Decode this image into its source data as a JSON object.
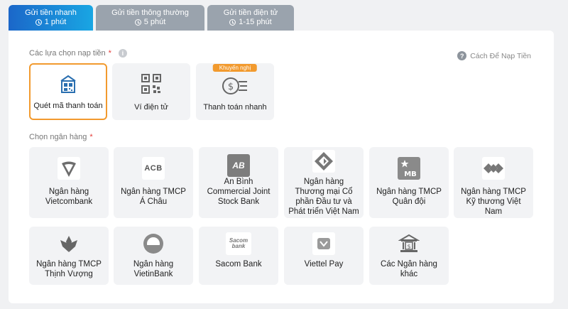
{
  "tabs": [
    {
      "label": "Gửi tiền nhanh",
      "time": "1 phút",
      "active": true
    },
    {
      "label": "Gửi tiền thông thường",
      "time": "5 phút",
      "active": false
    },
    {
      "label": "Gửi tiền điện tử",
      "time": "1-15 phút",
      "active": false
    }
  ],
  "deposit_options": {
    "label": "Các lựa chọn nạp tiền",
    "required_mark": "*",
    "info_icon": "i",
    "guide": {
      "icon": "?",
      "label": "Cách Để Nạp Tiền"
    },
    "methods": [
      {
        "label": "Quét mã thanh toán",
        "icon": "qr-scan-icon"
      },
      {
        "label": "Ví điện tử",
        "icon": "qr-code-icon"
      },
      {
        "label": "Thanh toán nhanh",
        "icon": "fast-payment-icon",
        "badge": "Khuyến nghị"
      }
    ]
  },
  "bank_section": {
    "label": "Chọn ngân hàng",
    "required_mark": "*"
  },
  "banks": [
    {
      "name": "Ngân hàng Vietcombank",
      "logo_text": ""
    },
    {
      "name": "Ngân hàng TMCP Á Châu",
      "logo_text": "ACB"
    },
    {
      "name": "An Bình Commercial Joint Stock Bank",
      "logo_text": "AB"
    },
    {
      "name": "Ngân hàng Thương mại Cổ phần Đầu tư và Phát triển Việt Nam",
      "logo_text": ""
    },
    {
      "name": "Ngân hàng TMCP Quân đội",
      "logo_text": "MB"
    },
    {
      "name": "Ngân hàng TMCP Kỹ thương Việt Nam",
      "logo_text": ""
    },
    {
      "name": "Ngân hàng TMCP Thịnh Vượng",
      "logo_text": ""
    },
    {
      "name": "Ngân hàng VietinBank",
      "logo_text": ""
    },
    {
      "name": "Sacom Bank",
      "logo_text": "Sacom bank"
    },
    {
      "name": "Viettel Pay",
      "logo_text": ""
    },
    {
      "name": "Các Ngân hàng khác",
      "logo_text": ""
    }
  ],
  "colors": {
    "tab_active_start": "#1b67c9",
    "tab_active_end": "#19a6e3",
    "tab_inactive": "#9aa3ad",
    "selected_border": "#f29a2e",
    "required": "#e53935"
  }
}
